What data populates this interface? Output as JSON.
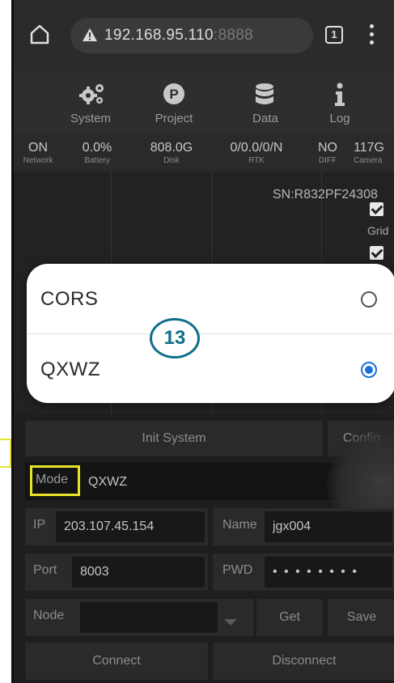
{
  "browser": {
    "url_host": "192.168.95.110",
    "url_port": ":8888",
    "tab_count": "1",
    "icons": [
      "home-icon",
      "warning-icon",
      "tab-switcher-icon",
      "overflow-menu-icon"
    ]
  },
  "nav": {
    "items": [
      {
        "label": "System",
        "icon": "gears-icon"
      },
      {
        "label": "Project",
        "icon": "project-p-icon"
      },
      {
        "label": "Data",
        "icon": "database-icon"
      },
      {
        "label": "Log",
        "icon": "info-icon"
      }
    ]
  },
  "status": {
    "items": [
      {
        "value": "ON",
        "label": "Network"
      },
      {
        "value": "0.0%",
        "label": "Battery"
      },
      {
        "value": "808.0G",
        "label": "Disk"
      },
      {
        "value": "0/0.0/0/N",
        "label": "RTK"
      },
      {
        "value": "NO",
        "label": "DIFF"
      },
      {
        "value": "117G",
        "label": "Camera"
      }
    ]
  },
  "map": {
    "sn": "SN:R832PF24308",
    "grid_label": "Grid"
  },
  "dialog": {
    "options": [
      {
        "label": "CORS",
        "selected": false
      },
      {
        "label": "QXWZ",
        "selected": true
      }
    ],
    "accent_color": "#1e6fdb"
  },
  "step_badge": "13",
  "controls": {
    "init_system": "Init System",
    "config": "Config",
    "mode_label": "Mode",
    "mode_value": "QXWZ",
    "ip_label": "IP",
    "ip_value": "203.107.45.154",
    "name_label": "Name",
    "name_value": "jgx004",
    "port_label": "Port",
    "port_value": "8003",
    "pwd_label": "PWD",
    "pwd_value": "• • • • • • • •",
    "node_label": "Node",
    "node_value": "",
    "get": "Get",
    "save": "Save",
    "connect": "Connect",
    "disconnect": "Disconnect"
  },
  "highlight_color": "#e8e32a"
}
